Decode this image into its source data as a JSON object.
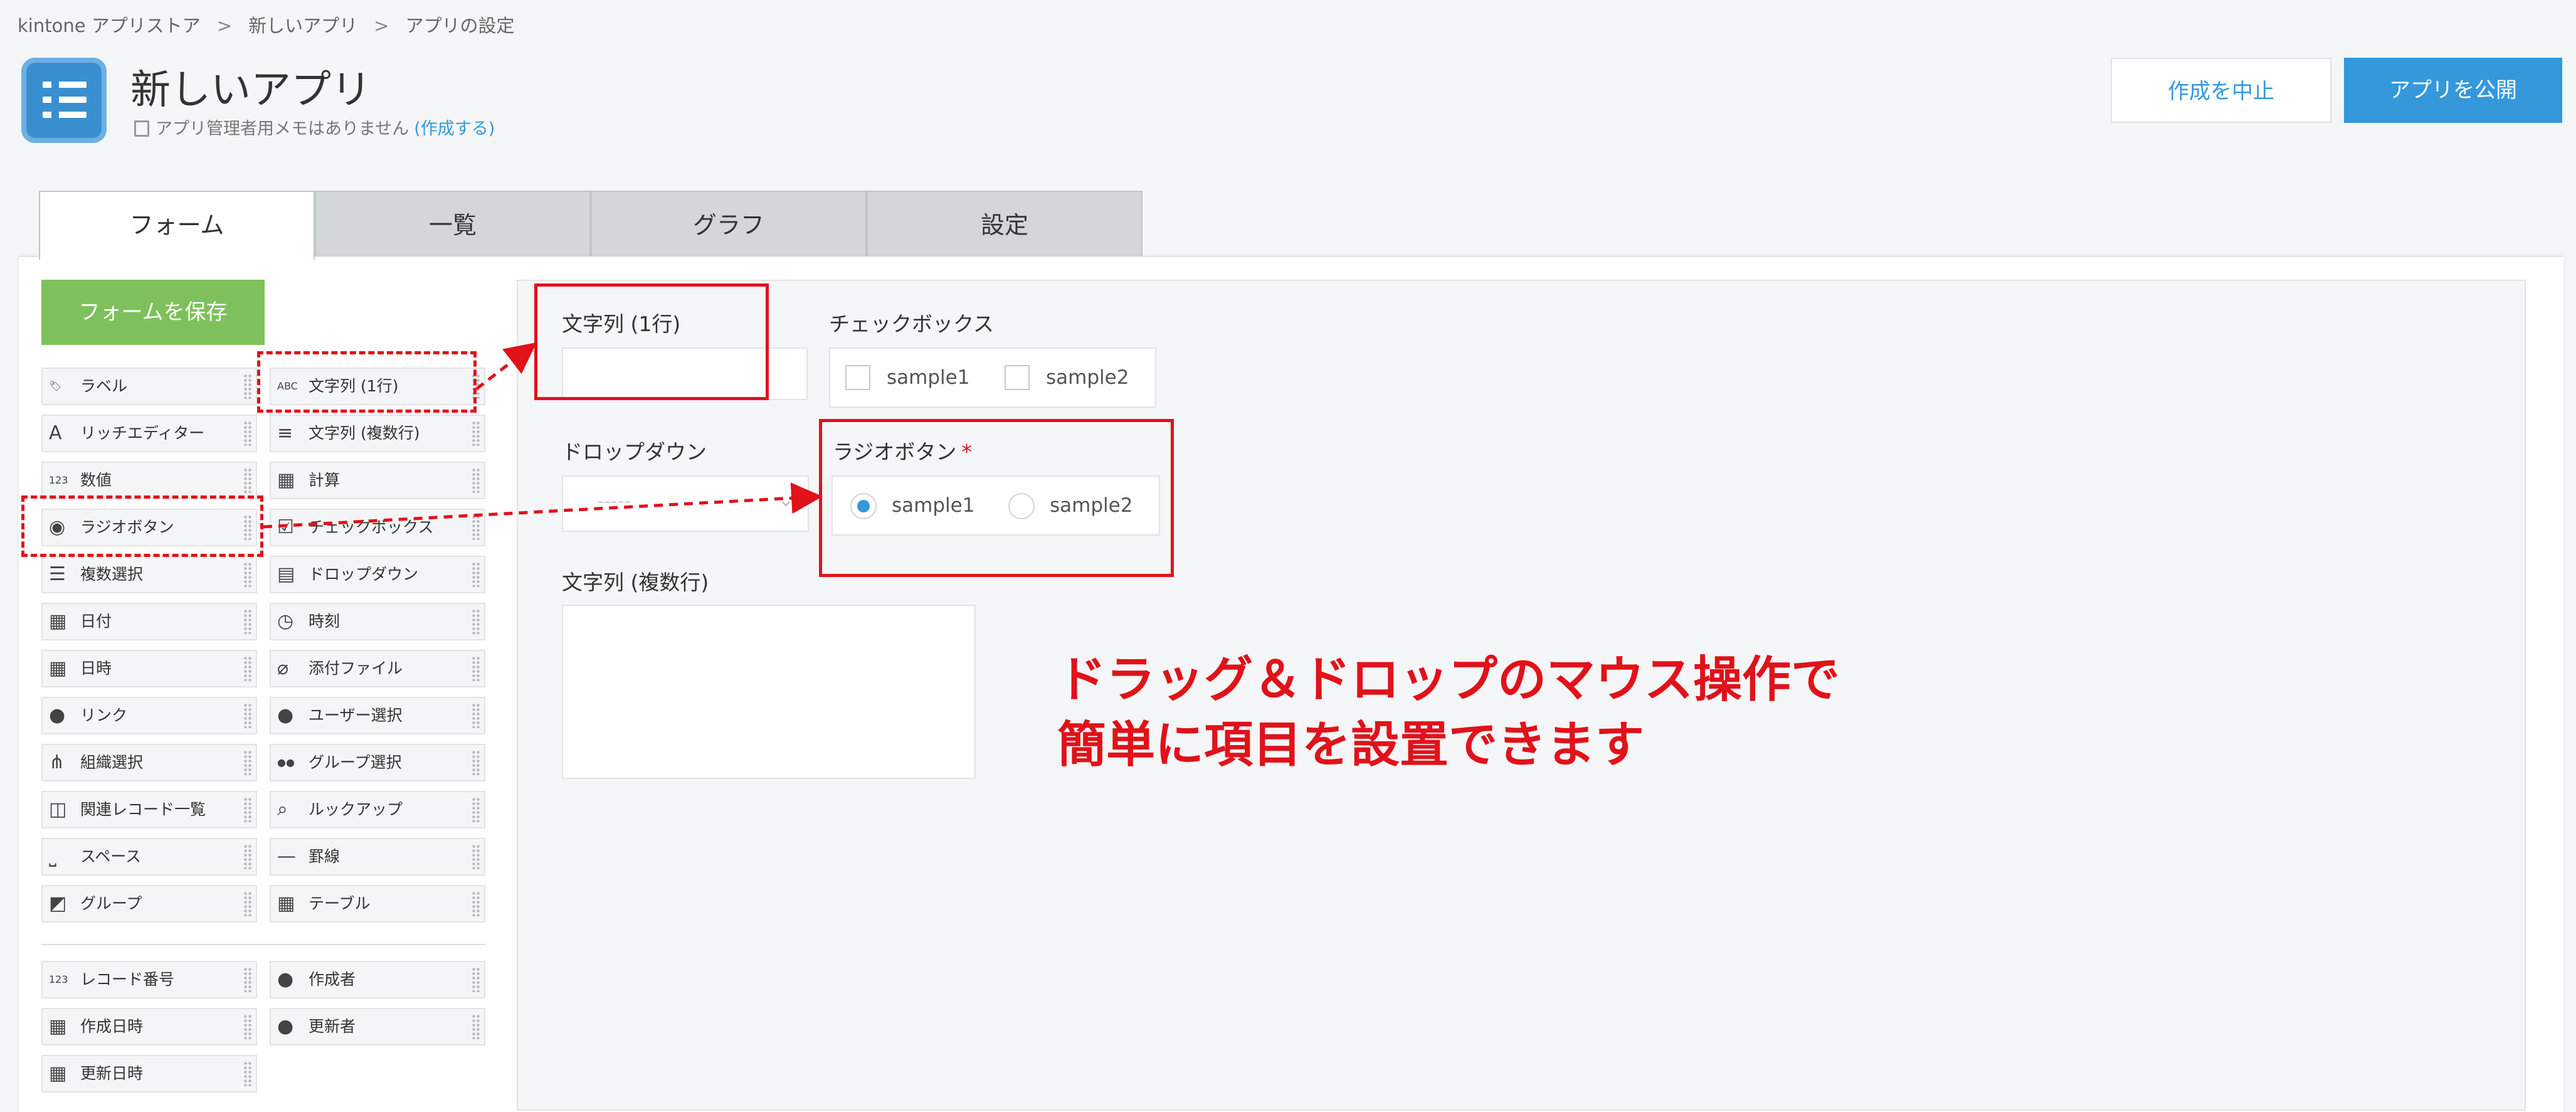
{
  "breadcrumb": [
    "kintone アプリストア",
    "新しいアプリ",
    "アプリの設定"
  ],
  "breadcrumb_separator": ">",
  "app": {
    "title": "新しいアプリ",
    "memo_text": "アプリ管理者用メモはありません",
    "memo_link": "(作成する)"
  },
  "header_buttons": {
    "cancel": "作成を中止",
    "publish": "アプリを公開"
  },
  "tabs": [
    "フォーム",
    "一覧",
    "グラフ",
    "設定"
  ],
  "active_tab": "フォーム",
  "form": {
    "save_button": "フォームを保存",
    "palette": [
      {
        "label": "ラベル",
        "icon": "tag-icon"
      },
      {
        "label": "文字列 (1行)",
        "icon": "abc-icon"
      },
      {
        "label": "リッチエディター",
        "icon": "rich-text-icon"
      },
      {
        "label": "文字列 (複数行)",
        "icon": "multiline-icon"
      },
      {
        "label": "数値",
        "icon": "number-icon"
      },
      {
        "label": "計算",
        "icon": "calculator-icon"
      },
      {
        "label": "ラジオボタン",
        "icon": "radio-icon"
      },
      {
        "label": "チェックボックス",
        "icon": "checkbox-icon"
      },
      {
        "label": "複数選択",
        "icon": "multi-select-icon"
      },
      {
        "label": "ドロップダウン",
        "icon": "dropdown-icon"
      },
      {
        "label": "日付",
        "icon": "calendar-icon"
      },
      {
        "label": "時刻",
        "icon": "clock-icon"
      },
      {
        "label": "日時",
        "icon": "calendar-icon"
      },
      {
        "label": "添付ファイル",
        "icon": "paperclip-icon"
      },
      {
        "label": "リンク",
        "icon": "globe-icon"
      },
      {
        "label": "ユーザー選択",
        "icon": "user-icon"
      },
      {
        "label": "組織選択",
        "icon": "org-icon"
      },
      {
        "label": "グループ選択",
        "icon": "group-icon"
      },
      {
        "label": "関連レコード一覧",
        "icon": "related-records-icon"
      },
      {
        "label": "ルックアップ",
        "icon": "lookup-icon"
      },
      {
        "label": "スペース",
        "icon": "space-icon"
      },
      {
        "label": "罫線",
        "icon": "line-icon"
      },
      {
        "label": "グループ",
        "icon": "group-folder-icon"
      },
      {
        "label": "テーブル",
        "icon": "table-icon"
      }
    ],
    "system_palette": [
      {
        "label": "レコード番号",
        "icon": "number-icon"
      },
      {
        "label": "作成者",
        "icon": "user-icon"
      },
      {
        "label": "作成日時",
        "icon": "calendar-icon"
      },
      {
        "label": "更新者",
        "icon": "user-icon"
      },
      {
        "label": "更新日時",
        "icon": "calendar-icon"
      }
    ],
    "canvas": {
      "single_line_label": "文字列 (1行)",
      "checkbox_label": "チェックボックス",
      "checkbox_options": [
        "sample1",
        "sample2"
      ],
      "dropdown_label": "ドロップダウン",
      "dropdown_value": "-----",
      "radio_label": "ラジオボタン",
      "radio_required_mark": "*",
      "radio_options": [
        "sample1",
        "sample2"
      ],
      "radio_selected": "sample1",
      "multiline_label": "文字列 (複数行)"
    }
  },
  "annotation": {
    "line1": "ドラッグ＆ドロップのマウス操作で",
    "line2": "簡単に項目を設置できます",
    "color": "#e0121a"
  },
  "colors": {
    "accent": "#3498db",
    "save_green": "#7ec15c",
    "highlight_red": "#e0121a"
  }
}
